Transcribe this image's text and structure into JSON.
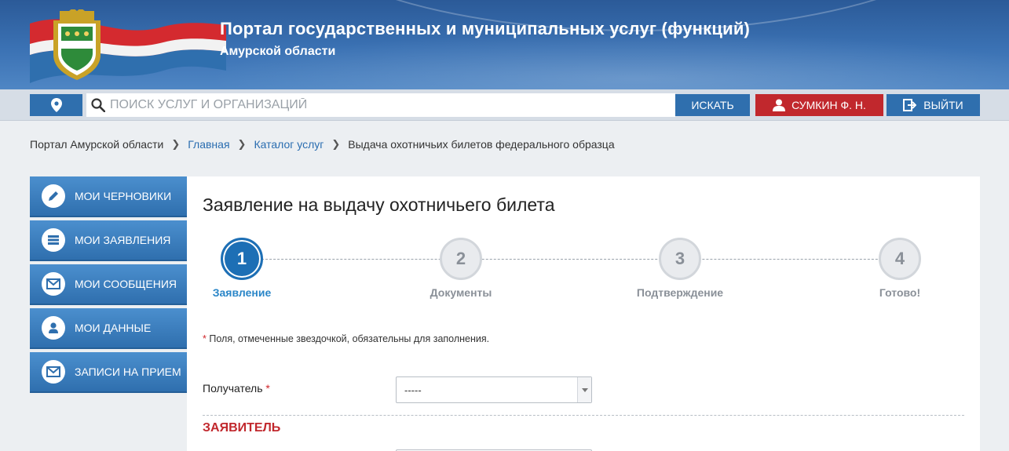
{
  "header": {
    "title": "Портал государственных и муниципальных услуг (функций)",
    "subtitle": "Амурской области",
    "colors": {
      "flag_red": "#c1282d",
      "flag_blue": "#2f6fae",
      "emblem_green": "#2e8b3a"
    }
  },
  "searchbar": {
    "location_icon": "map-marker-icon",
    "placeholder": "ПОИСК УСЛУГ И ОРГАНИЗАЦИЙ",
    "search_label": "ИСКАТЬ",
    "user_label": "СУМКИН Ф. Н.",
    "logout_label": "ВЫЙТИ"
  },
  "breadcrumb": {
    "root": "Портал Амурской области",
    "home": "Главная",
    "catalog": "Каталог услуг",
    "current": "Выдача охотничьих билетов федерального образца"
  },
  "sidebar": {
    "items": [
      {
        "label": "МОИ ЧЕРНОВИКИ",
        "icon": "pencil-icon"
      },
      {
        "label": "МОИ ЗАЯВЛЕНИЯ",
        "icon": "list-icon"
      },
      {
        "label": "МОИ СООБЩЕНИЯ",
        "icon": "envelope-icon"
      },
      {
        "label": "МОИ ДАННЫЕ",
        "icon": "user-icon"
      },
      {
        "label": "ЗАПИСИ НА ПРИЕМ",
        "icon": "envelope-icon"
      }
    ]
  },
  "main": {
    "title": "Заявление на выдачу охотничьего билета",
    "steps": [
      {
        "num": "1",
        "label": "Заявление",
        "active": true
      },
      {
        "num": "2",
        "label": "Документы",
        "active": false
      },
      {
        "num": "3",
        "label": "Подтверждение",
        "active": false
      },
      {
        "num": "4",
        "label": "Готово!",
        "active": false
      }
    ],
    "required_mark": "*",
    "required_note": "Поля, отмеченные звездочкой, обязательны для заполнения.",
    "recipient_label": "Получатель",
    "recipient_value": "-----",
    "section_title": "ЗАЯВИТЕЛЬ"
  }
}
